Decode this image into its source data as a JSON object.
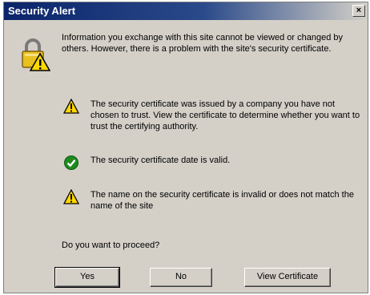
{
  "window": {
    "title": "Security Alert",
    "close_glyph": "×"
  },
  "intro": "Information you exchange with this site cannot be viewed or changed by others. However, there is a problem with the site's security certificate.",
  "items": [
    {
      "icon": "warning-icon",
      "text": "The security certificate was issued by a company you have not chosen to trust. View the certificate to determine whether you want to trust the certifying authority."
    },
    {
      "icon": "check-icon",
      "text": "The security certificate date is valid."
    },
    {
      "icon": "warning-icon",
      "text": "The name on the security certificate is invalid or does not match the name of the site"
    }
  ],
  "prompt": "Do you want to proceed?",
  "buttons": {
    "yes": "Yes",
    "no": "No",
    "view_certificate": "View Certificate"
  },
  "colors": {
    "titlebar": "#0a246a",
    "dialog": "#d4d0c8",
    "warning": "#ffd800",
    "check": "#1e8a1e"
  }
}
